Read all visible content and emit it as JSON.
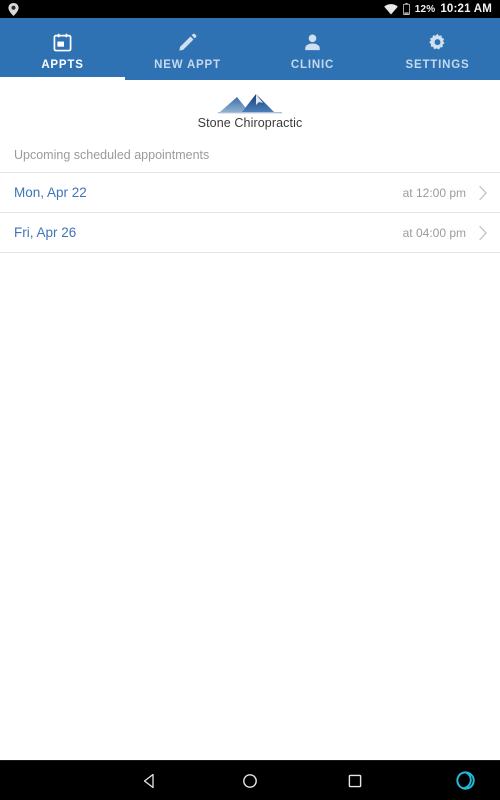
{
  "status_bar": {
    "left_icon": "location-pin-icon",
    "wifi_icon": "wifi-icon",
    "battery_icon": "battery-icon",
    "battery_percent": "12%",
    "time": "10:21 AM"
  },
  "tabs": [
    {
      "label": "APPTS",
      "icon": "calendar-icon",
      "active": true
    },
    {
      "label": "NEW APPT",
      "icon": "pencil-icon",
      "active": false
    },
    {
      "label": "CLINIC",
      "icon": "person-icon",
      "active": false
    },
    {
      "label": "SETTINGS",
      "icon": "gear-icon",
      "active": false
    }
  ],
  "brand": {
    "logo_icon": "mountain-logo-icon",
    "name": "Stone Chiropractic"
  },
  "main": {
    "section_label": "Upcoming scheduled appointments",
    "appointments": [
      {
        "date": "Mon, Apr 22",
        "time": "at 12:00 pm",
        "chevron": "chevron-right-icon"
      },
      {
        "date": "Fri, Apr 26",
        "time": "at 04:00 pm",
        "chevron": "chevron-right-icon"
      }
    ]
  },
  "nav_bar": {
    "back": "back-triangle-icon",
    "home": "home-circle-icon",
    "recents": "recents-square-icon",
    "assistant": "assistant-ring-icon"
  },
  "colors": {
    "header_blue": "#2f72b4",
    "link_blue": "#3f74b8",
    "muted_gray": "#9b9b9b",
    "assistant_cyan": "#22b8d8",
    "divider": "#e3e3e3"
  }
}
